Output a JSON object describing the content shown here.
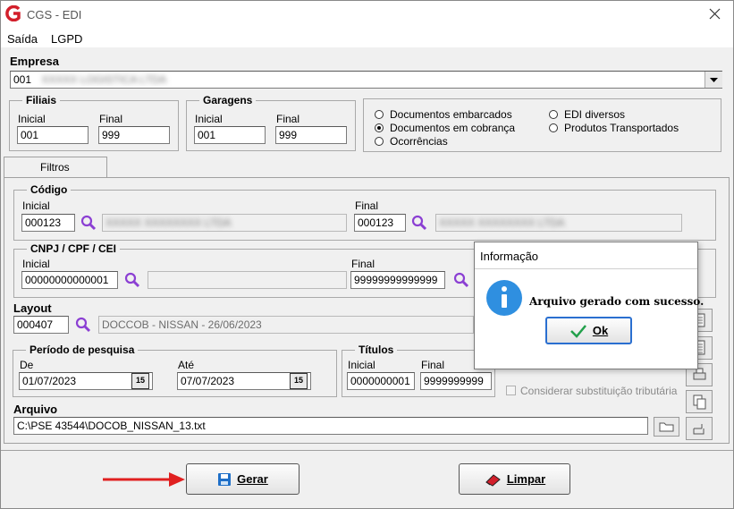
{
  "window": {
    "title": "CGS - EDI"
  },
  "menu": {
    "items": [
      "Saída",
      "LGPD"
    ]
  },
  "empresa": {
    "label": "Empresa",
    "value": "001",
    "blurred_name": "XXXXX LOGISTICA LTDA"
  },
  "filiais": {
    "title": "Filiais",
    "inicial_label": "Inicial",
    "inicial": "001",
    "final_label": "Final",
    "final": "999"
  },
  "garagens": {
    "title": "Garagens",
    "inicial_label": "Inicial",
    "inicial": "001",
    "final_label": "Final",
    "final": "999"
  },
  "doc_options": {
    "embarcados": "Documentos embarcados",
    "cobranca": "Documentos em cobrança",
    "ocorrencias": "Ocorrências",
    "edi_diversos": "EDI diversos",
    "produtos": "Produtos Transportados",
    "selected": "Documentos em cobrança"
  },
  "tab": {
    "label": "Filtros"
  },
  "codigo": {
    "title": "Código",
    "inicial_label": "Inicial",
    "inicial": "000123",
    "inicial_name": "XXXXX XXXXXXXX LTDA",
    "final_label": "Final",
    "final": "000123",
    "final_name": "XXXXX XXXXXXXX LTDA"
  },
  "cnpj": {
    "title": "CNPJ / CPF / CEI",
    "inicial_label": "Inicial",
    "inicial": "00000000000001",
    "final_label": "Final",
    "final": "99999999999999"
  },
  "layout": {
    "label": "Layout",
    "code": "000407",
    "description": "DOCCOB - NISSAN - 26/06/2023"
  },
  "periodo": {
    "title": "Período de pesquisa",
    "de_label": "De",
    "de": "01/07/2023",
    "ate_label": "Até",
    "ate": "07/07/2023",
    "cal_label": "15"
  },
  "titulos": {
    "title": "Títulos",
    "inicial_label": "Inicial",
    "inicial": "0000000001",
    "final_label": "Final",
    "final": "9999999999"
  },
  "substituicao": {
    "label": "Considerar substituição tributária",
    "checked": false
  },
  "arquivo": {
    "label": "Arquivo",
    "path": "C:\\PSE 43544\\DOCOB_NISSAN_13.txt"
  },
  "buttons": {
    "gerar": "Gerar",
    "limpar": "Limpar"
  },
  "dialog": {
    "title": "Informação",
    "message": "Arquivo gerado com sucesso.",
    "ok": "Ok"
  },
  "colors": {
    "accent_red": "#d21f2b",
    "info_blue": "#2f8fe0",
    "ok_green": "#22a04b",
    "magnifier": "#8b3fd3",
    "arrow_red": "#e02020"
  }
}
